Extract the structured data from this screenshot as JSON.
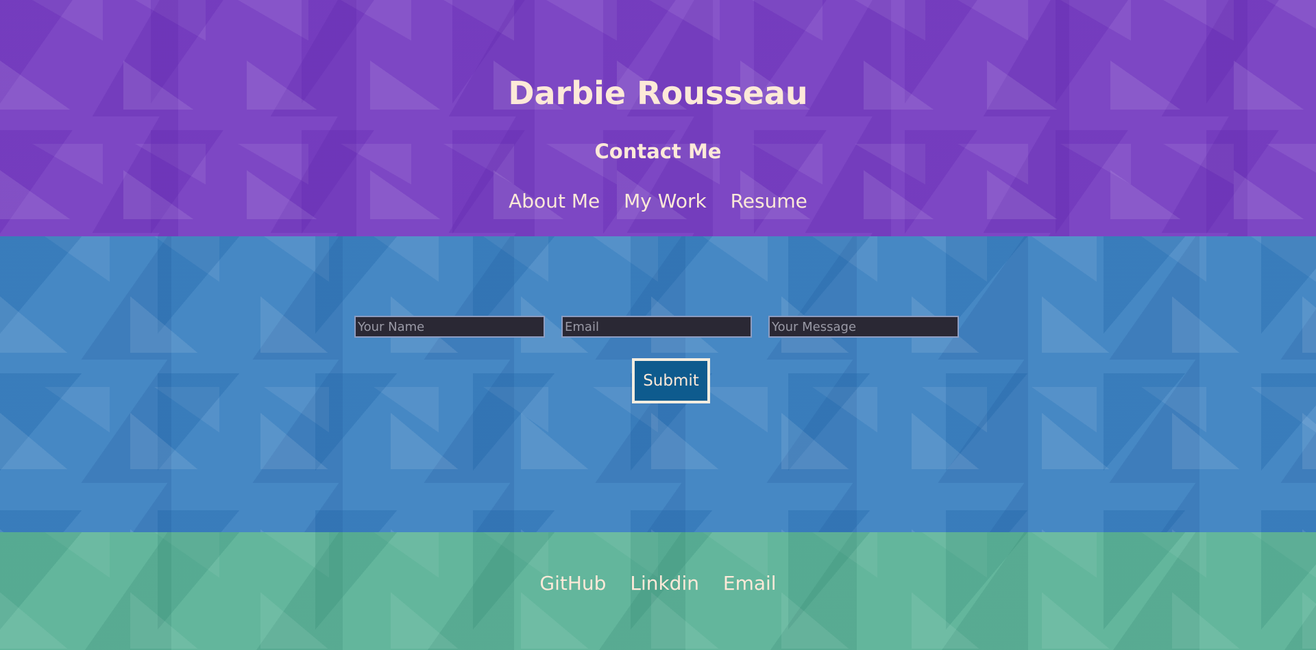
{
  "header": {
    "title": "Darbie Rousseau",
    "page_heading": "Contact Me",
    "nav": [
      {
        "label": "About Me"
      },
      {
        "label": "My Work"
      },
      {
        "label": "Resume"
      }
    ]
  },
  "form": {
    "name_placeholder": "Your Name",
    "email_placeholder": "Email",
    "message_placeholder": "Your Message",
    "submit_label": "Submit"
  },
  "footer": {
    "links": [
      {
        "label": "GitHub"
      },
      {
        "label": "Linkdin"
      },
      {
        "label": "Email"
      }
    ]
  },
  "colors": {
    "header_bg": "#7d47c4",
    "main_bg": "#4688c4",
    "footer_bg": "#63b69c",
    "text": "#fde9d8",
    "submit_bg": "#0e5b8e"
  }
}
